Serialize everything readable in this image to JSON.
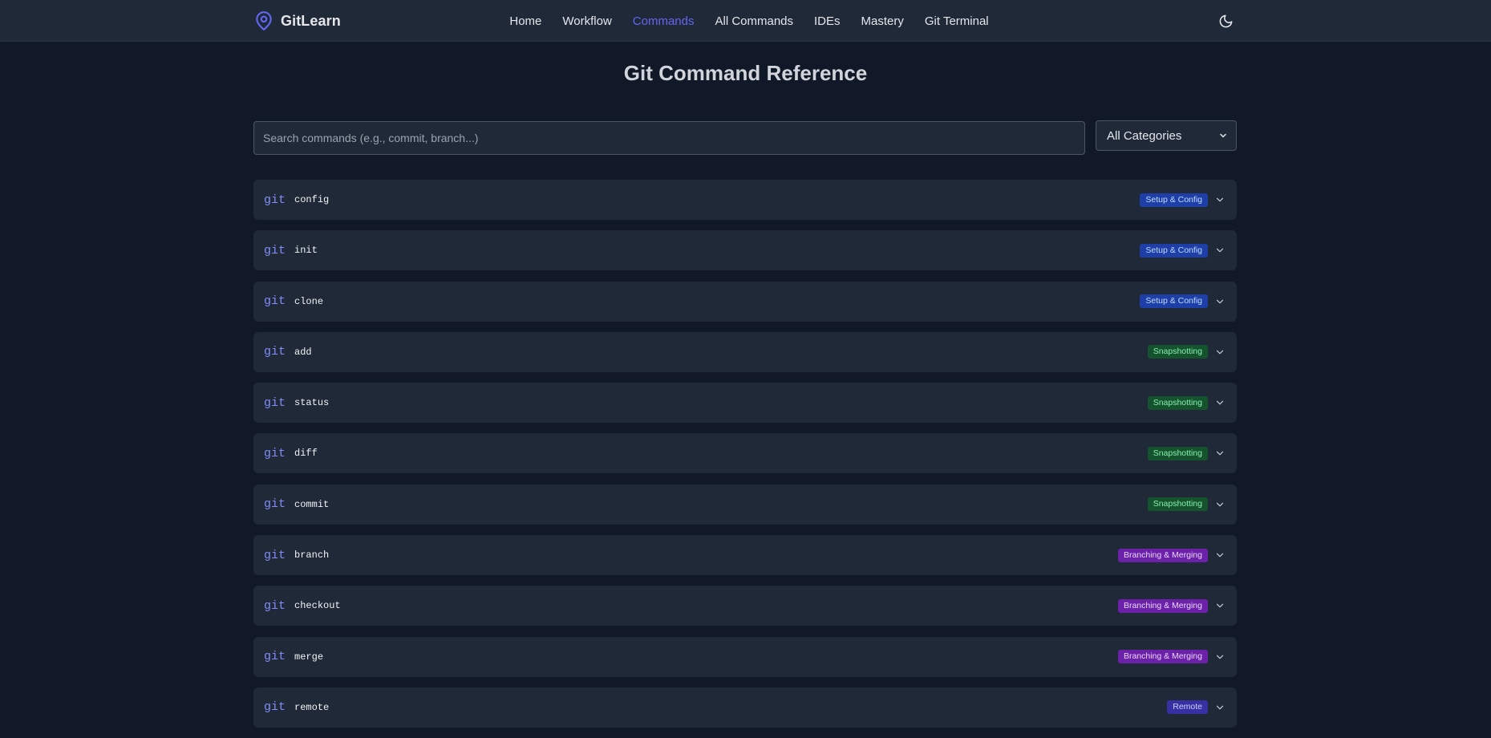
{
  "colors": {
    "page_bg": "#111827",
    "nav_bg": "#1f2937",
    "card_bg": "#1f2937",
    "accent": "#6366f1",
    "git_prefix": "#818cf8",
    "badge_setup": "#1e3fa8",
    "badge_snapshotting": "#14532d",
    "badge_branching": "#6b21a8",
    "badge_remote": "#3730a3"
  },
  "brand": {
    "name": "GitLearn",
    "icon": "map-pin-icon"
  },
  "nav": {
    "items": [
      {
        "label": "Home",
        "active": false
      },
      {
        "label": "Workflow",
        "active": false
      },
      {
        "label": "Commands",
        "active": true
      },
      {
        "label": "All Commands",
        "active": false
      },
      {
        "label": "IDEs",
        "active": false
      },
      {
        "label": "Mastery",
        "active": false
      },
      {
        "label": "Git Terminal",
        "active": false
      }
    ],
    "theme_toggle_icon": "moon-icon"
  },
  "page": {
    "title": "Git Command Reference"
  },
  "search": {
    "placeholder": "Search commands (e.g., commit, branch...)",
    "value": ""
  },
  "category_filter": {
    "selected": "All Categories",
    "icon": "chevron-down-icon"
  },
  "commands": [
    {
      "prefix": "git",
      "name": "config",
      "category": "Setup & Config"
    },
    {
      "prefix": "git",
      "name": "init",
      "category": "Setup & Config"
    },
    {
      "prefix": "git",
      "name": "clone",
      "category": "Setup & Config"
    },
    {
      "prefix": "git",
      "name": "add",
      "category": "Snapshotting"
    },
    {
      "prefix": "git",
      "name": "status",
      "category": "Snapshotting"
    },
    {
      "prefix": "git",
      "name": "diff",
      "category": "Snapshotting"
    },
    {
      "prefix": "git",
      "name": "commit",
      "category": "Snapshotting"
    },
    {
      "prefix": "git",
      "name": "branch",
      "category": "Branching & Merging"
    },
    {
      "prefix": "git",
      "name": "checkout",
      "category": "Branching & Merging"
    },
    {
      "prefix": "git",
      "name": "merge",
      "category": "Branching & Merging"
    },
    {
      "prefix": "git",
      "name": "remote",
      "category": "Remote"
    }
  ]
}
